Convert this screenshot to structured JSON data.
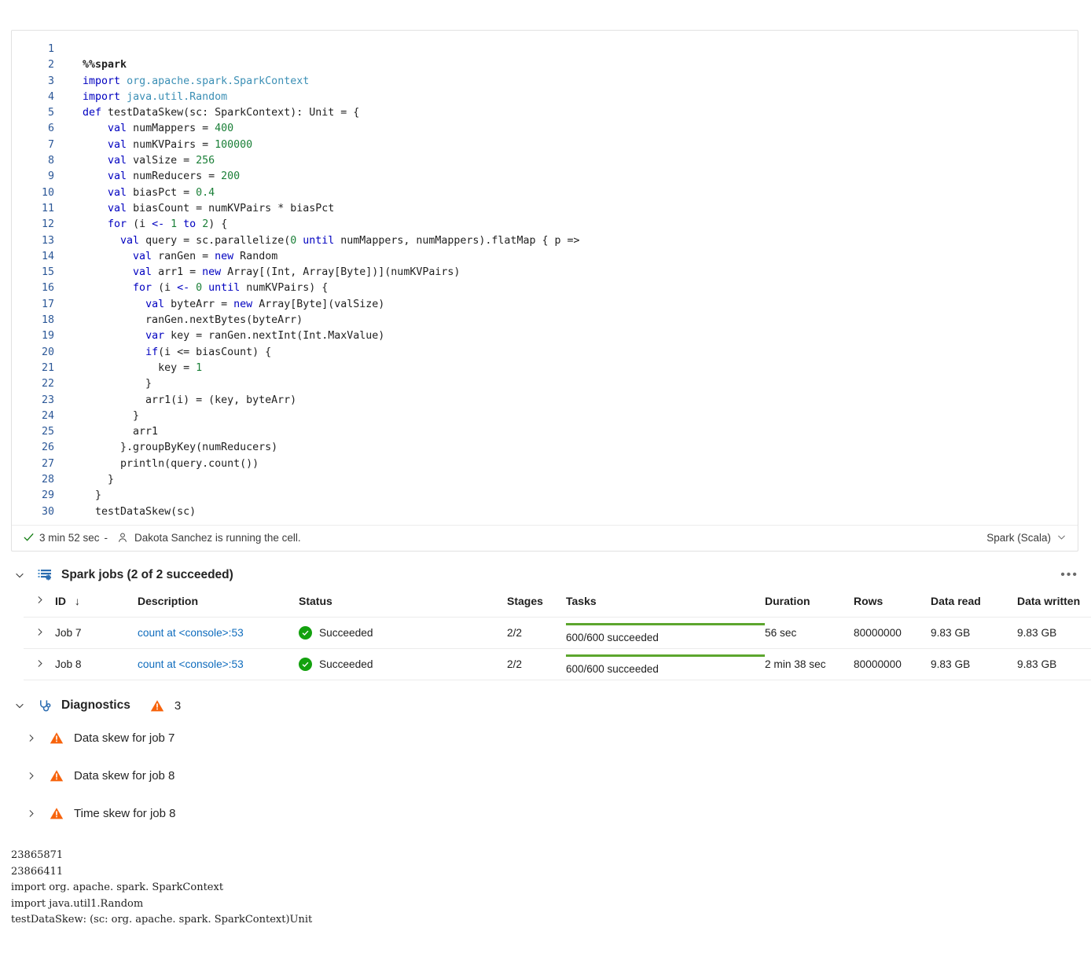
{
  "cell": {
    "language": "Spark (Scala)",
    "status": {
      "duration": "3 min 52 sec",
      "separator": "-",
      "message": "Dakota Sanchez is running the cell."
    },
    "lines": [
      {
        "n": "1",
        "tokens": []
      },
      {
        "n": "2",
        "tokens": [
          {
            "t": "%%spark",
            "c": "pct"
          }
        ]
      },
      {
        "n": "3",
        "tokens": [
          {
            "t": "import",
            "c": "kw"
          },
          {
            "t": " ",
            "c": "pln"
          },
          {
            "t": "org.apache.spark.SparkContext",
            "c": "typ"
          }
        ]
      },
      {
        "n": "4",
        "tokens": [
          {
            "t": "import",
            "c": "kw"
          },
          {
            "t": " ",
            "c": "pln"
          },
          {
            "t": "java.util.Random",
            "c": "typ"
          }
        ]
      },
      {
        "n": "5",
        "tokens": [
          {
            "t": "def",
            "c": "kw"
          },
          {
            "t": " testDataSkew(sc: SparkContext): Unit = {",
            "c": "pln"
          }
        ]
      },
      {
        "n": "6",
        "tokens": [
          {
            "t": "    ",
            "c": "pln"
          },
          {
            "t": "val",
            "c": "kw"
          },
          {
            "t": " numMappers = ",
            "c": "pln"
          },
          {
            "t": "400",
            "c": "num"
          }
        ]
      },
      {
        "n": "7",
        "tokens": [
          {
            "t": "    ",
            "c": "pln"
          },
          {
            "t": "val",
            "c": "kw"
          },
          {
            "t": " numKVPairs = ",
            "c": "pln"
          },
          {
            "t": "100000",
            "c": "num"
          }
        ]
      },
      {
        "n": "8",
        "tokens": [
          {
            "t": "    ",
            "c": "pln"
          },
          {
            "t": "val",
            "c": "kw"
          },
          {
            "t": " valSize = ",
            "c": "pln"
          },
          {
            "t": "256",
            "c": "num"
          }
        ]
      },
      {
        "n": "9",
        "tokens": [
          {
            "t": "    ",
            "c": "pln"
          },
          {
            "t": "val",
            "c": "kw"
          },
          {
            "t": " numReducers = ",
            "c": "pln"
          },
          {
            "t": "200",
            "c": "num"
          }
        ]
      },
      {
        "n": "10",
        "tokens": [
          {
            "t": "    ",
            "c": "pln"
          },
          {
            "t": "val",
            "c": "kw"
          },
          {
            "t": " biasPct = ",
            "c": "pln"
          },
          {
            "t": "0.4",
            "c": "num"
          }
        ]
      },
      {
        "n": "11",
        "tokens": [
          {
            "t": "    ",
            "c": "pln"
          },
          {
            "t": "val",
            "c": "kw"
          },
          {
            "t": " biasCount = numKVPairs * biasPct",
            "c": "pln"
          }
        ]
      },
      {
        "n": "12",
        "tokens": [
          {
            "t": "    ",
            "c": "pln"
          },
          {
            "t": "for",
            "c": "kw"
          },
          {
            "t": " (i ",
            "c": "pln"
          },
          {
            "t": "<-",
            "c": "kw"
          },
          {
            "t": " ",
            "c": "pln"
          },
          {
            "t": "1",
            "c": "num"
          },
          {
            "t": " ",
            "c": "pln"
          },
          {
            "t": "to",
            "c": "kw"
          },
          {
            "t": " ",
            "c": "pln"
          },
          {
            "t": "2",
            "c": "num"
          },
          {
            "t": ") {",
            "c": "pln"
          }
        ]
      },
      {
        "n": "13",
        "tokens": [
          {
            "t": "      ",
            "c": "pln"
          },
          {
            "t": "val",
            "c": "kw"
          },
          {
            "t": " query = sc.parallelize(",
            "c": "pln"
          },
          {
            "t": "0",
            "c": "num"
          },
          {
            "t": " ",
            "c": "pln"
          },
          {
            "t": "until",
            "c": "kw"
          },
          {
            "t": " numMappers, numMappers).flatMap { p =>",
            "c": "pln"
          }
        ]
      },
      {
        "n": "14",
        "tokens": [
          {
            "t": "        ",
            "c": "pln"
          },
          {
            "t": "val",
            "c": "kw"
          },
          {
            "t": " ranGen = ",
            "c": "pln"
          },
          {
            "t": "new",
            "c": "kw"
          },
          {
            "t": " Random",
            "c": "pln"
          }
        ]
      },
      {
        "n": "15",
        "tokens": [
          {
            "t": "        ",
            "c": "pln"
          },
          {
            "t": "val",
            "c": "kw"
          },
          {
            "t": " arr1 = ",
            "c": "pln"
          },
          {
            "t": "new",
            "c": "kw"
          },
          {
            "t": " Array[(Int, Array[Byte])](numKVPairs)",
            "c": "pln"
          }
        ]
      },
      {
        "n": "16",
        "tokens": [
          {
            "t": "        ",
            "c": "pln"
          },
          {
            "t": "for",
            "c": "kw"
          },
          {
            "t": " (i ",
            "c": "pln"
          },
          {
            "t": "<-",
            "c": "kw"
          },
          {
            "t": " ",
            "c": "pln"
          },
          {
            "t": "0",
            "c": "num"
          },
          {
            "t": " ",
            "c": "pln"
          },
          {
            "t": "until",
            "c": "kw"
          },
          {
            "t": " numKVPairs) {",
            "c": "pln"
          }
        ]
      },
      {
        "n": "17",
        "tokens": [
          {
            "t": "          ",
            "c": "pln"
          },
          {
            "t": "val",
            "c": "kw"
          },
          {
            "t": " byteArr = ",
            "c": "pln"
          },
          {
            "t": "new",
            "c": "kw"
          },
          {
            "t": " Array[Byte](valSize)",
            "c": "pln"
          }
        ]
      },
      {
        "n": "18",
        "tokens": [
          {
            "t": "          ranGen.nextBytes(byteArr)",
            "c": "pln"
          }
        ]
      },
      {
        "n": "19",
        "tokens": [
          {
            "t": "          ",
            "c": "pln"
          },
          {
            "t": "var",
            "c": "kw"
          },
          {
            "t": " key = ranGen.nextInt(Int.MaxValue)",
            "c": "pln"
          }
        ]
      },
      {
        "n": "20",
        "tokens": [
          {
            "t": "          ",
            "c": "pln"
          },
          {
            "t": "if",
            "c": "kw"
          },
          {
            "t": "(i <= biasCount) {",
            "c": "pln"
          }
        ]
      },
      {
        "n": "21",
        "tokens": [
          {
            "t": "            key = ",
            "c": "pln"
          },
          {
            "t": "1",
            "c": "num"
          }
        ]
      },
      {
        "n": "22",
        "tokens": [
          {
            "t": "          }",
            "c": "pln"
          }
        ]
      },
      {
        "n": "23",
        "tokens": [
          {
            "t": "          arr1(i) = (key, byteArr)",
            "c": "pln"
          }
        ]
      },
      {
        "n": "24",
        "tokens": [
          {
            "t": "        }",
            "c": "pln"
          }
        ]
      },
      {
        "n": "25",
        "tokens": [
          {
            "t": "        arr1",
            "c": "pln"
          }
        ]
      },
      {
        "n": "26",
        "tokens": [
          {
            "t": "      }.groupByKey(numReducers)",
            "c": "pln"
          }
        ]
      },
      {
        "n": "27",
        "tokens": [
          {
            "t": "      println(query.count())",
            "c": "pln"
          }
        ]
      },
      {
        "n": "28",
        "tokens": [
          {
            "t": "    }",
            "c": "pln"
          }
        ]
      },
      {
        "n": "29",
        "tokens": [
          {
            "t": "  }",
            "c": "pln"
          }
        ]
      },
      {
        "n": "30",
        "tokens": [
          {
            "t": "  testDataSkew(sc)",
            "c": "pln"
          }
        ]
      }
    ]
  },
  "spark_jobs": {
    "title": "Spark jobs (2 of 2 succeeded)",
    "kebab": "•••",
    "columns": [
      {
        "label": "",
        "key": "expand"
      },
      {
        "label": "ID",
        "key": "id",
        "sort": "↓"
      },
      {
        "label": "Description",
        "key": "description"
      },
      {
        "label": "Status",
        "key": "status"
      },
      {
        "label": "Stages",
        "key": "stages"
      },
      {
        "label": "Tasks",
        "key": "tasks"
      },
      {
        "label": "Duration",
        "key": "duration"
      },
      {
        "label": "Rows",
        "key": "rows"
      },
      {
        "label": "Data read",
        "key": "data_read"
      },
      {
        "label": "Data written",
        "key": "data_written"
      }
    ],
    "rows": [
      {
        "id": "Job 7",
        "description": "count at <console>:53",
        "status": "Succeeded",
        "stages": "2/2",
        "tasks": "600/600 succeeded",
        "tasks_percent": 100,
        "duration": "56 sec",
        "rows": "80000000",
        "data_read": "9.83 GB",
        "data_written": "9.83 GB"
      },
      {
        "id": "Job 8",
        "description": "count at <console>:53",
        "status": "Succeeded",
        "stages": "2/2",
        "tasks": "600/600 succeeded",
        "tasks_percent": 100,
        "duration": "2 min 38 sec",
        "rows": "80000000",
        "data_read": "9.83 GB",
        "data_written": "9.83 GB"
      }
    ]
  },
  "diagnostics": {
    "title": "Diagnostics",
    "count": "3",
    "items": [
      {
        "label": "Data skew for job 7"
      },
      {
        "label": "Data skew for job 8"
      },
      {
        "label": "Time skew for job 8"
      }
    ]
  },
  "console_output": {
    "lines": [
      "23865871",
      "23866411",
      "import org. apache. spark. SparkContext",
      "import java.util1.Random",
      "testDataSkew: (sc: org. apache. spark. SparkContext)Unit"
    ]
  },
  "colors": {
    "success_green": "#13a10e",
    "bar_green": "#5ca62e",
    "warning_orange": "#f7630c",
    "link_blue": "#0f6cbd",
    "icon_blue": "#2b6cb0"
  }
}
